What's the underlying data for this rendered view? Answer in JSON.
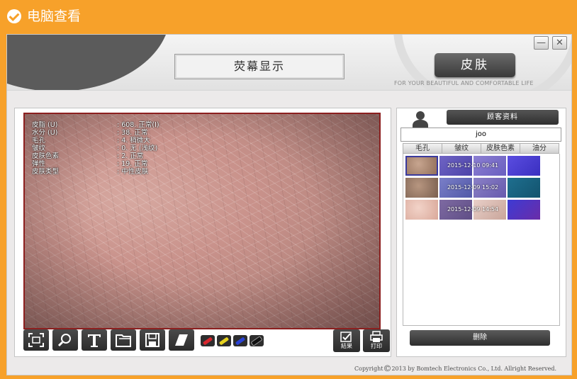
{
  "topbar": {
    "title": "电脑查看",
    "icon": "check-circle-icon"
  },
  "header": {
    "screen_title": "荧幕显示",
    "skin_button": "皮肤",
    "tagline": "FOR YOUR BEAUTIFUL AND COMFORTABLE LIFE",
    "minimize": "—",
    "close": "✕"
  },
  "viewer": {
    "metrics": [
      {
        "label": "皮脂 (U)",
        "value": ": 608. 正常(I)"
      },
      {
        "label": "水分 (U)",
        "value": ": 38. 正常"
      },
      {
        "label": "毛孔",
        "value": ": 4. 稍微大"
      },
      {
        "label": "皱纹",
        "value": ": 0. 无 (浅纹)"
      },
      {
        "label": "皮肤色素",
        "value": ": 2. 正常"
      },
      {
        "label": "弹性",
        "value": ": 19. 正常"
      },
      {
        "label": "皮肤类型",
        "value": ": 中性皮肤"
      }
    ]
  },
  "toolbar": {
    "tools": [
      "fit-screen-icon",
      "zoom-icon",
      "text-icon",
      "open-folder-icon",
      "save-icon",
      "eraser-icon"
    ],
    "pens": [
      {
        "name": "red-pen-icon",
        "color": "#d8262d"
      },
      {
        "name": "yellow-pen-icon",
        "color": "#e6d21e"
      },
      {
        "name": "blue-pen-icon",
        "color": "#2a43d6"
      },
      {
        "name": "black-pen-icon",
        "color": "#111111"
      }
    ],
    "result_label": "結果",
    "print_label": "打印"
  },
  "customer": {
    "button": "顾客资料",
    "name": "joo",
    "tabs": [
      "毛孔",
      "皱纹",
      "皮肤色素",
      "油分"
    ],
    "dates": [
      "2015-12-10 09:41",
      "2015-12-09 15:02",
      "2015-12-09 14:54"
    ],
    "delete": "删除"
  },
  "footer": {
    "copyright_pre": "Copyright",
    "copyright_symbol": "©",
    "copyright_post": "2013 by Bomtech Electronics Co., Ltd. Allright Reserved."
  }
}
